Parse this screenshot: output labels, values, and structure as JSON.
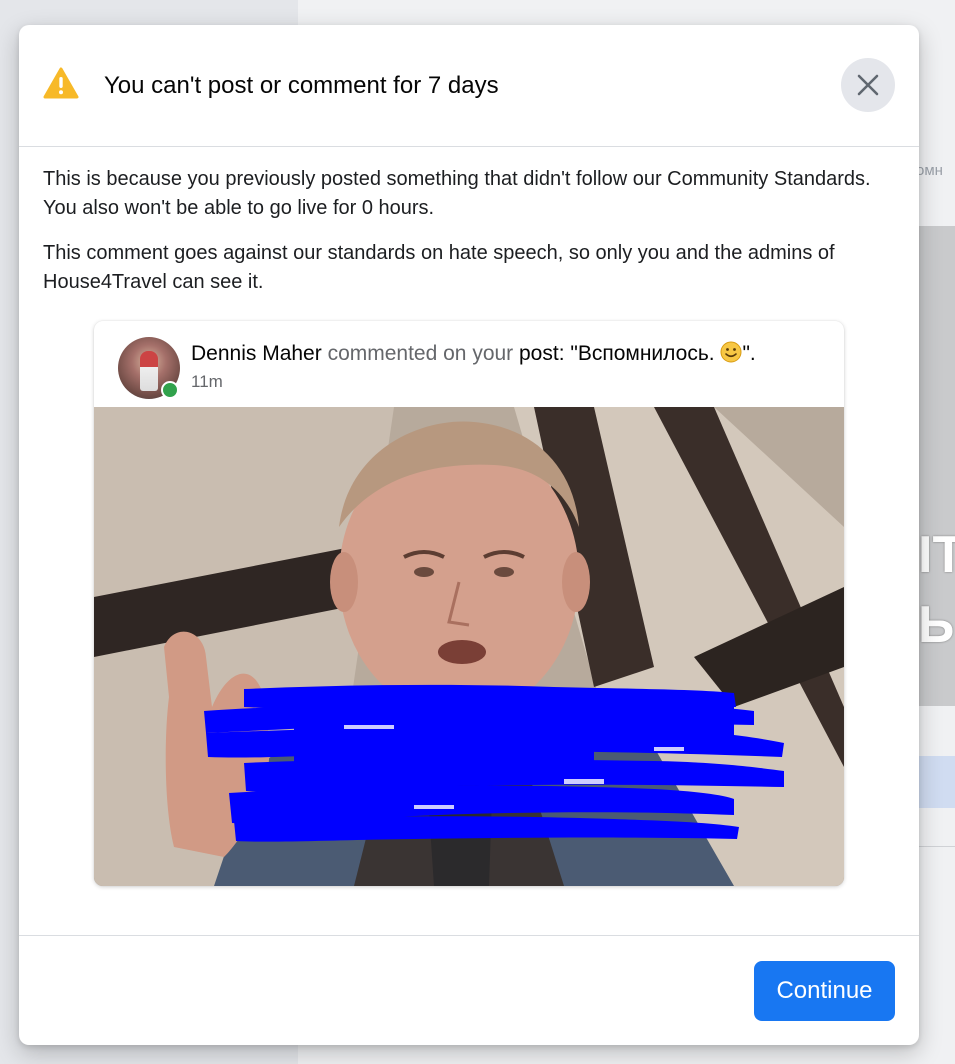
{
  "background": {
    "snippet_text": "омн",
    "image_text": "ITO\nЫ"
  },
  "dialog": {
    "title": "You can't post or comment for 7 days",
    "close_label": "Close",
    "body_paragraph_1": "This is because you previously posted something that didn't follow our Community Standards. You also won't be able to go live for 0 hours.",
    "body_paragraph_2": "This comment goes against our standards on hate speech, so only you and the admins of House4Travel can see it.",
    "continue_label": "Continue"
  },
  "notification": {
    "author": "Dennis Maher",
    "action": " commented on your ",
    "target": "post",
    "colon": ": ",
    "quote_open": "\"Вспомнилось. ",
    "quote_close": "\".",
    "time": "11m",
    "author_online": true
  },
  "colors": {
    "primary_button": "#1877f2",
    "warning_icon": "#f7b928",
    "online_dot": "#31a24c",
    "redaction": "#0000ff"
  },
  "icons": {
    "warning": "warning-triangle-icon",
    "close": "close-icon",
    "smiley": "smiley-emoji-icon"
  }
}
